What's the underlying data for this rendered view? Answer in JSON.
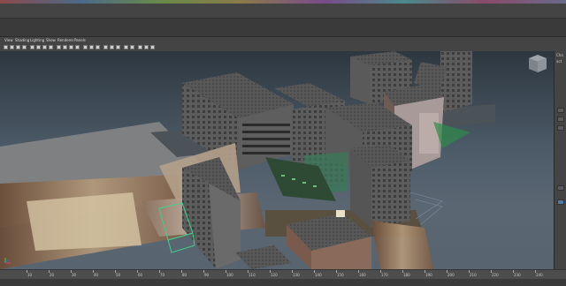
{
  "menus": {
    "view": "View",
    "shading": "Shading",
    "lighting": "Lighting",
    "show": "Show",
    "renderer": "Renderer",
    "panels": "Panels"
  },
  "right_panel": {
    "label_1": "Cha",
    "label_2": "act"
  },
  "timeline": {
    "ticks": [
      "10",
      "20",
      "30",
      "40",
      "50",
      "60",
      "70",
      "80",
      "90",
      "100",
      "110",
      "120",
      "130",
      "140",
      "150",
      "160",
      "170",
      "180",
      "190",
      "200",
      "210",
      "220",
      "230",
      "240"
    ]
  },
  "icons": {
    "view_cube": "view-cube-icon",
    "axis": "axis-gizmo-icon"
  },
  "colors": {
    "background": "#3c3c3c",
    "viewport_top": "#2d3740",
    "viewport_bottom": "#586470"
  }
}
